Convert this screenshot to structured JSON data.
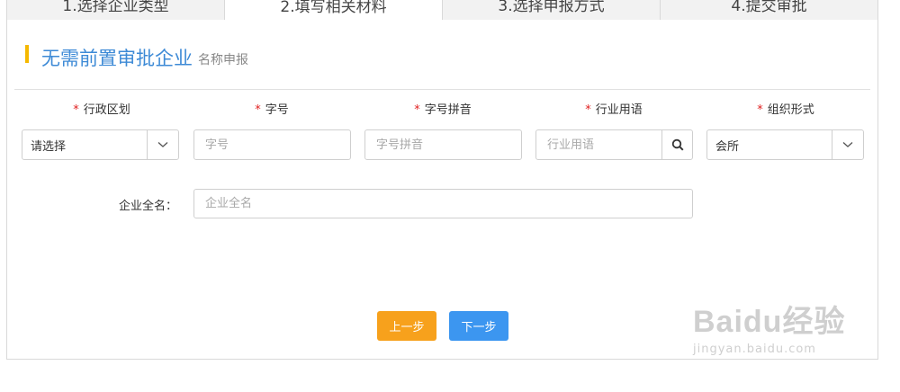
{
  "tabs": [
    {
      "label": "1.选择企业类型"
    },
    {
      "label": "2.填写相关材料"
    },
    {
      "label": "3.选择申报方式"
    },
    {
      "label": "4.提交审批"
    }
  ],
  "header": {
    "title": "无需前置审批企业",
    "subtitle": "名称申报"
  },
  "form": {
    "required_mark": "*",
    "fields": [
      {
        "label": "行政区划",
        "value": "请选择"
      },
      {
        "label": "字号",
        "placeholder": "字号"
      },
      {
        "label": "字号拼音",
        "placeholder": "字号拼音"
      },
      {
        "label": "行业用语",
        "placeholder": "行业用语"
      },
      {
        "label": "组织形式",
        "value": "会所"
      }
    ],
    "full_name": {
      "label": "企业全名：",
      "placeholder": "企业全名"
    }
  },
  "buttons": {
    "prev": "上一步",
    "next": "下一步"
  },
  "watermark": {
    "logo": "Baidu经验",
    "url": "jingyan.baidu.com"
  },
  "colors": {
    "accent": "#f5b800",
    "title": "#3d8ad6",
    "required": "#e02020",
    "prev_button": "#f7a11c",
    "next_button": "#3c96f0"
  }
}
